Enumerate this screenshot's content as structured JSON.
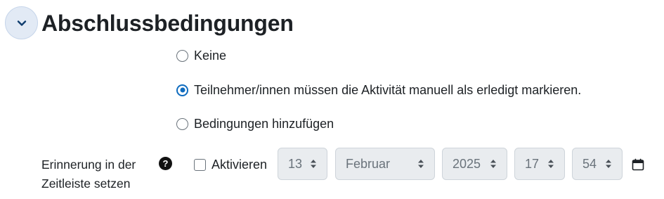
{
  "section": {
    "title": "Abschlussbedingungen",
    "collapse_icon": "chevron-down-icon"
  },
  "completion": {
    "options": [
      {
        "label": "Keine",
        "checked": false
      },
      {
        "label": "Teilnehmer/innen müssen die Aktivität manuell als erledigt markieren.",
        "checked": true
      },
      {
        "label": "Bedingungen hinzufügen",
        "checked": false
      }
    ]
  },
  "reminder": {
    "label_line1": "Erinnerung in der",
    "label_line2": "Zeitleiste setzen",
    "help_icon": "question-circle-icon",
    "help_glyph": "?",
    "enable_label": "Aktivieren",
    "enabled": false,
    "day": "13",
    "month": "Februar",
    "year": "2025",
    "hour": "17",
    "minute": "54",
    "calendar_icon": "calendar-icon"
  },
  "colors": {
    "accent": "#0f6cbf",
    "disabled_bg": "#e9ecef",
    "text": "#1d2125",
    "muted": "#6a737b"
  }
}
